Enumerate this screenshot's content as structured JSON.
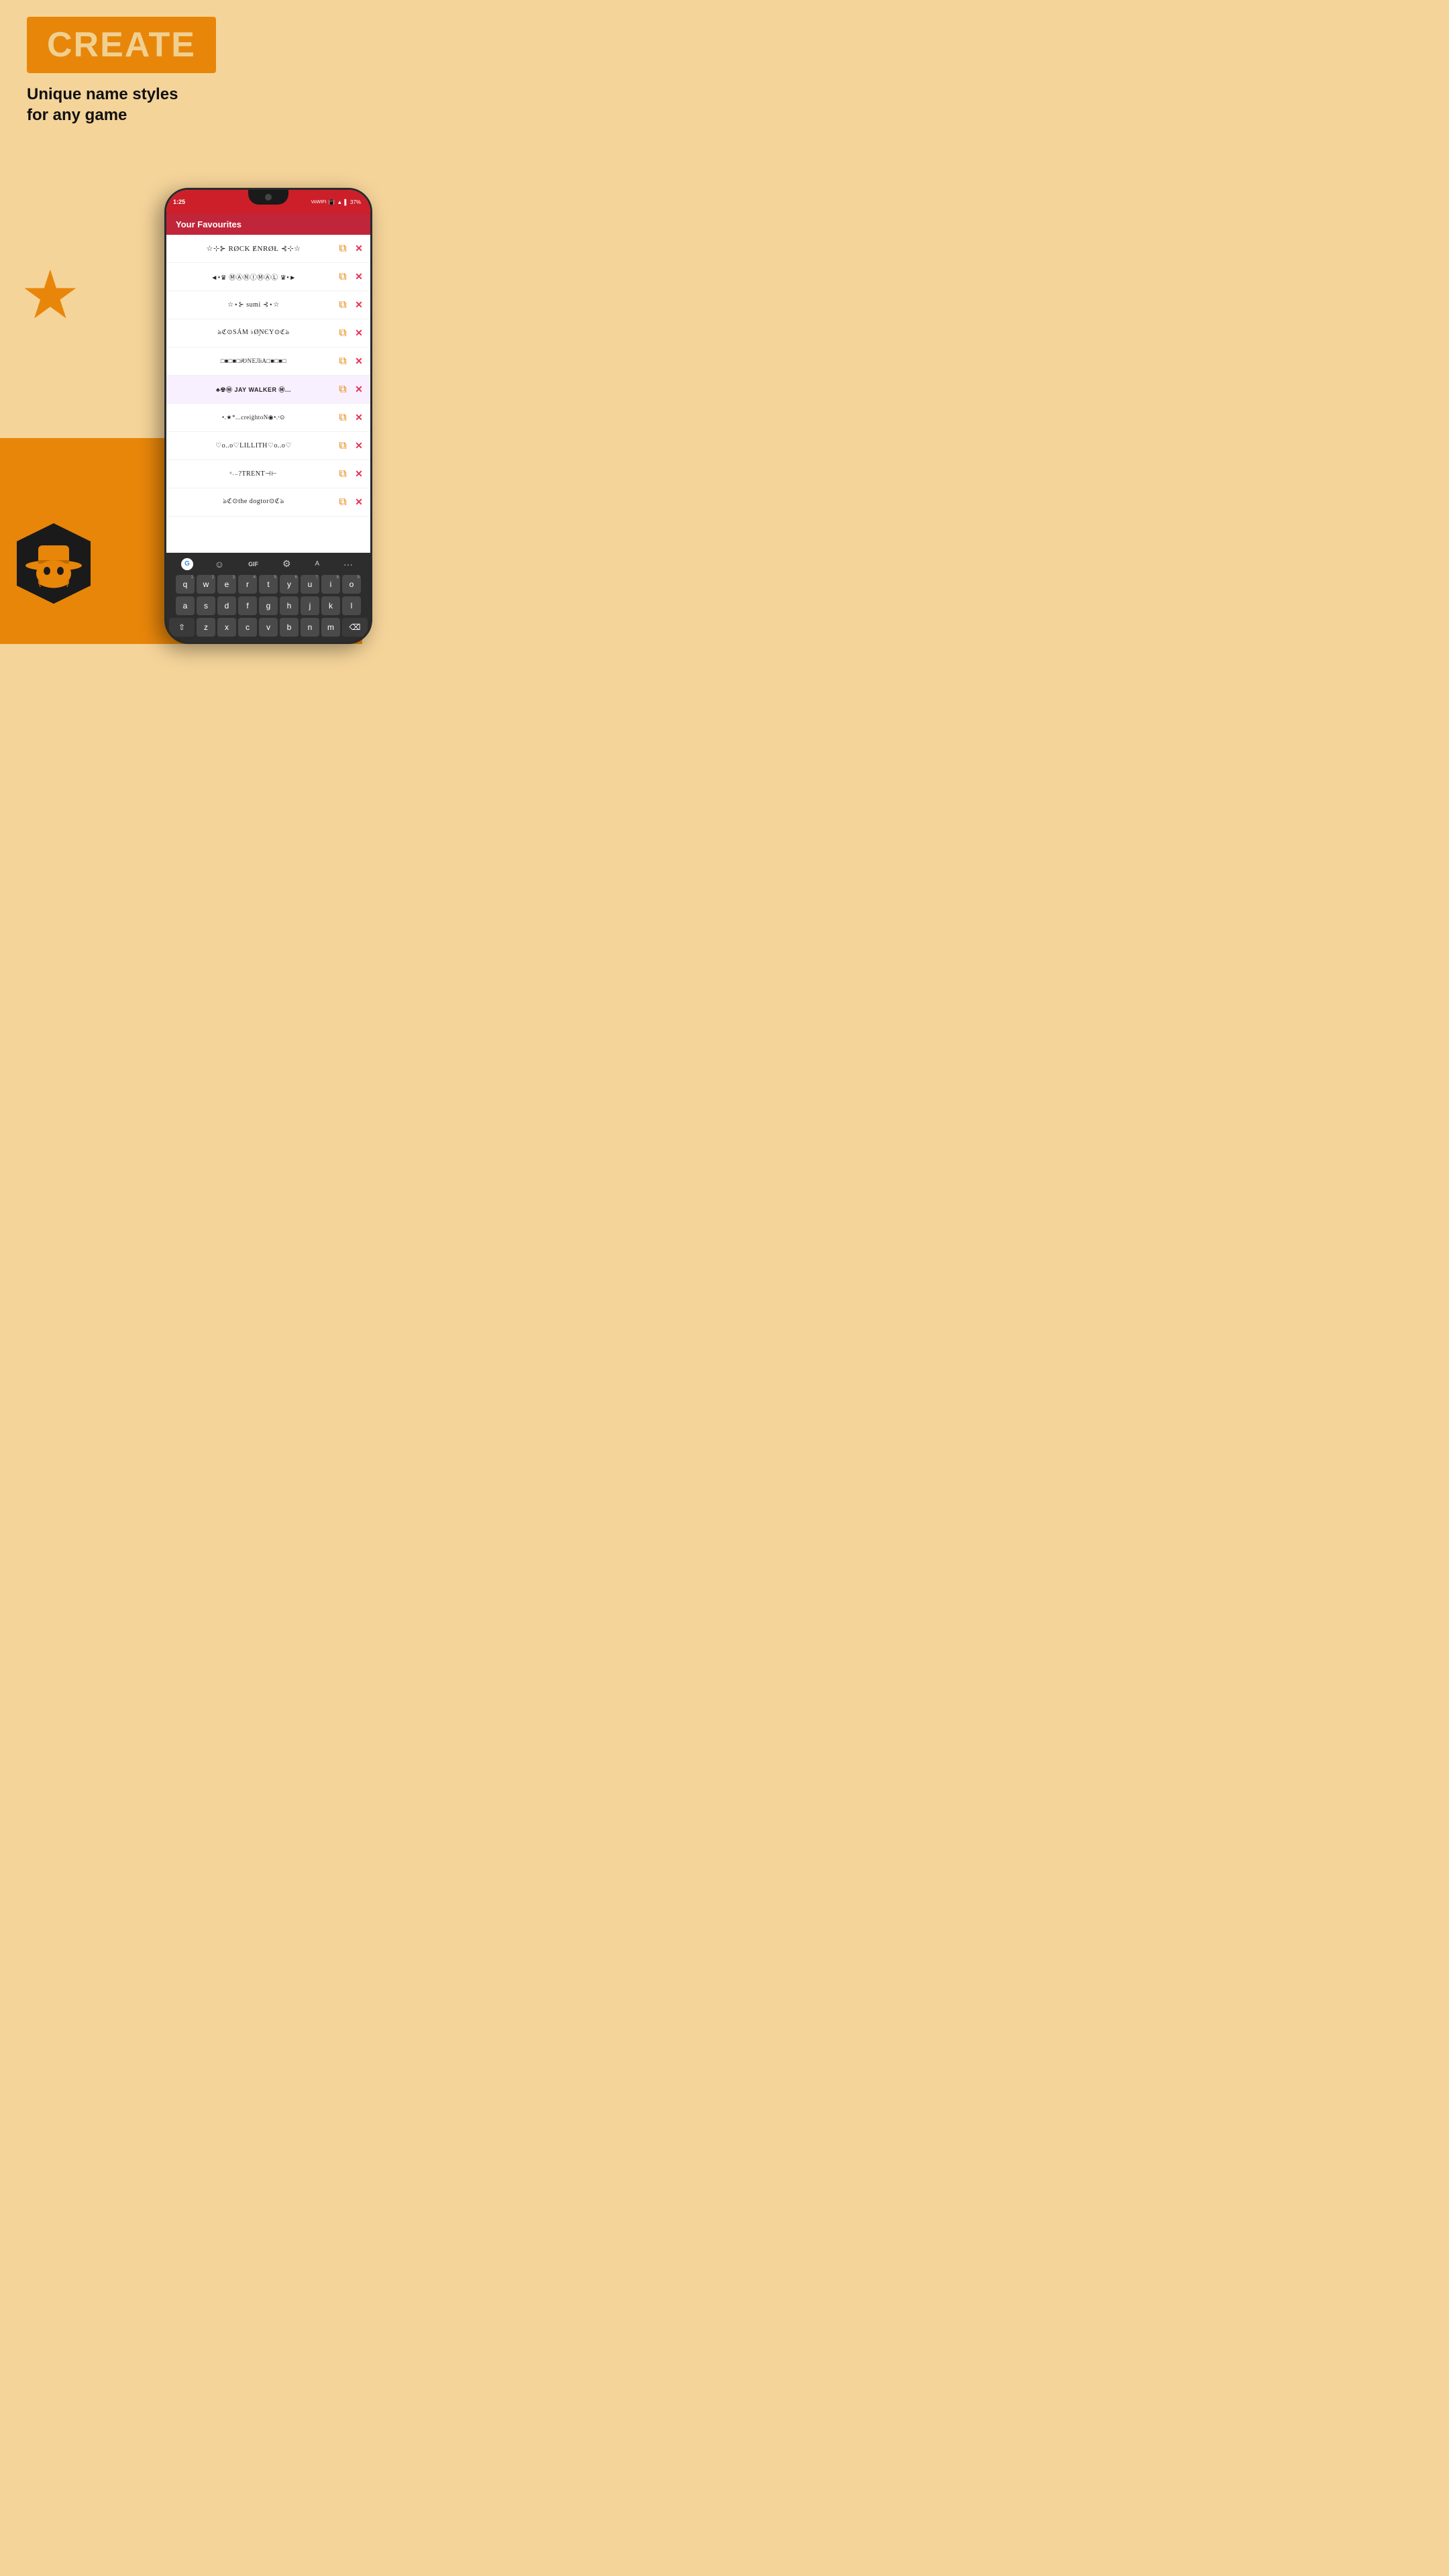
{
  "page": {
    "bg_top": "#f5d49a",
    "bg_bottom": "#e8860a"
  },
  "hero": {
    "create_label": "CREATE",
    "subtitle_line1": "Unique name styles",
    "subtitle_line2": "for any game"
  },
  "phone": {
    "status_time": "1:25",
    "status_battery": "37%",
    "header_title": "Your Favourites",
    "favourites": [
      {
        "name": "☆⊹⊱ RØCK ɆNRØŁ ⊰⊹☆"
      },
      {
        "name": "◄•♛ⓜⒶⓃⒾⓂⒶⓁ♛•►"
      },
      {
        "name": "☆⋆⊱ sumi ⊰⋆☆"
      },
      {
        "name": "ঌℭ⊙SÁM ♭ØƝЄY⊙ℭঌ"
      },
      {
        "name": "□■□■□•ᎥᎧNЕЛᎥA•□■□■□"
      },
      {
        "name": "♣☢ⓂAY WALKER♣..."
      },
      {
        "name": "•.★*...creiġhtoN◉•.ˢ⊙"
      },
      {
        "name": "♡o..o♡LILLITH♡o..o♡"
      },
      {
        "name": "ᵒ˒₋?TRENT⊣⊢"
      },
      {
        "name": "ঌℭ⊙the dogtor⊙ℭঌ"
      }
    ],
    "keyboard": {
      "row1": [
        "q",
        "w",
        "e",
        "r",
        "t",
        "y",
        "u",
        "i",
        "o"
      ],
      "row1_nums": [
        "1",
        "2",
        "3",
        "4",
        "5",
        "6",
        "7",
        "8",
        "9"
      ],
      "row2": [
        "a",
        "s",
        "d",
        "f",
        "g",
        "h",
        "j",
        "k",
        "l"
      ],
      "row3": [
        "z",
        "x",
        "c",
        "v",
        "b",
        "n",
        "m"
      ],
      "space_label": "",
      "backspace_label": "⌫"
    }
  },
  "icons": {
    "star": "★",
    "copy": "⧉",
    "delete": "✕",
    "shift": "⇧",
    "backspace": "⌫",
    "google_g": "G",
    "emoji": "☺",
    "gif": "GIF",
    "settings": "⚙",
    "translate": "A",
    "more": "···"
  }
}
